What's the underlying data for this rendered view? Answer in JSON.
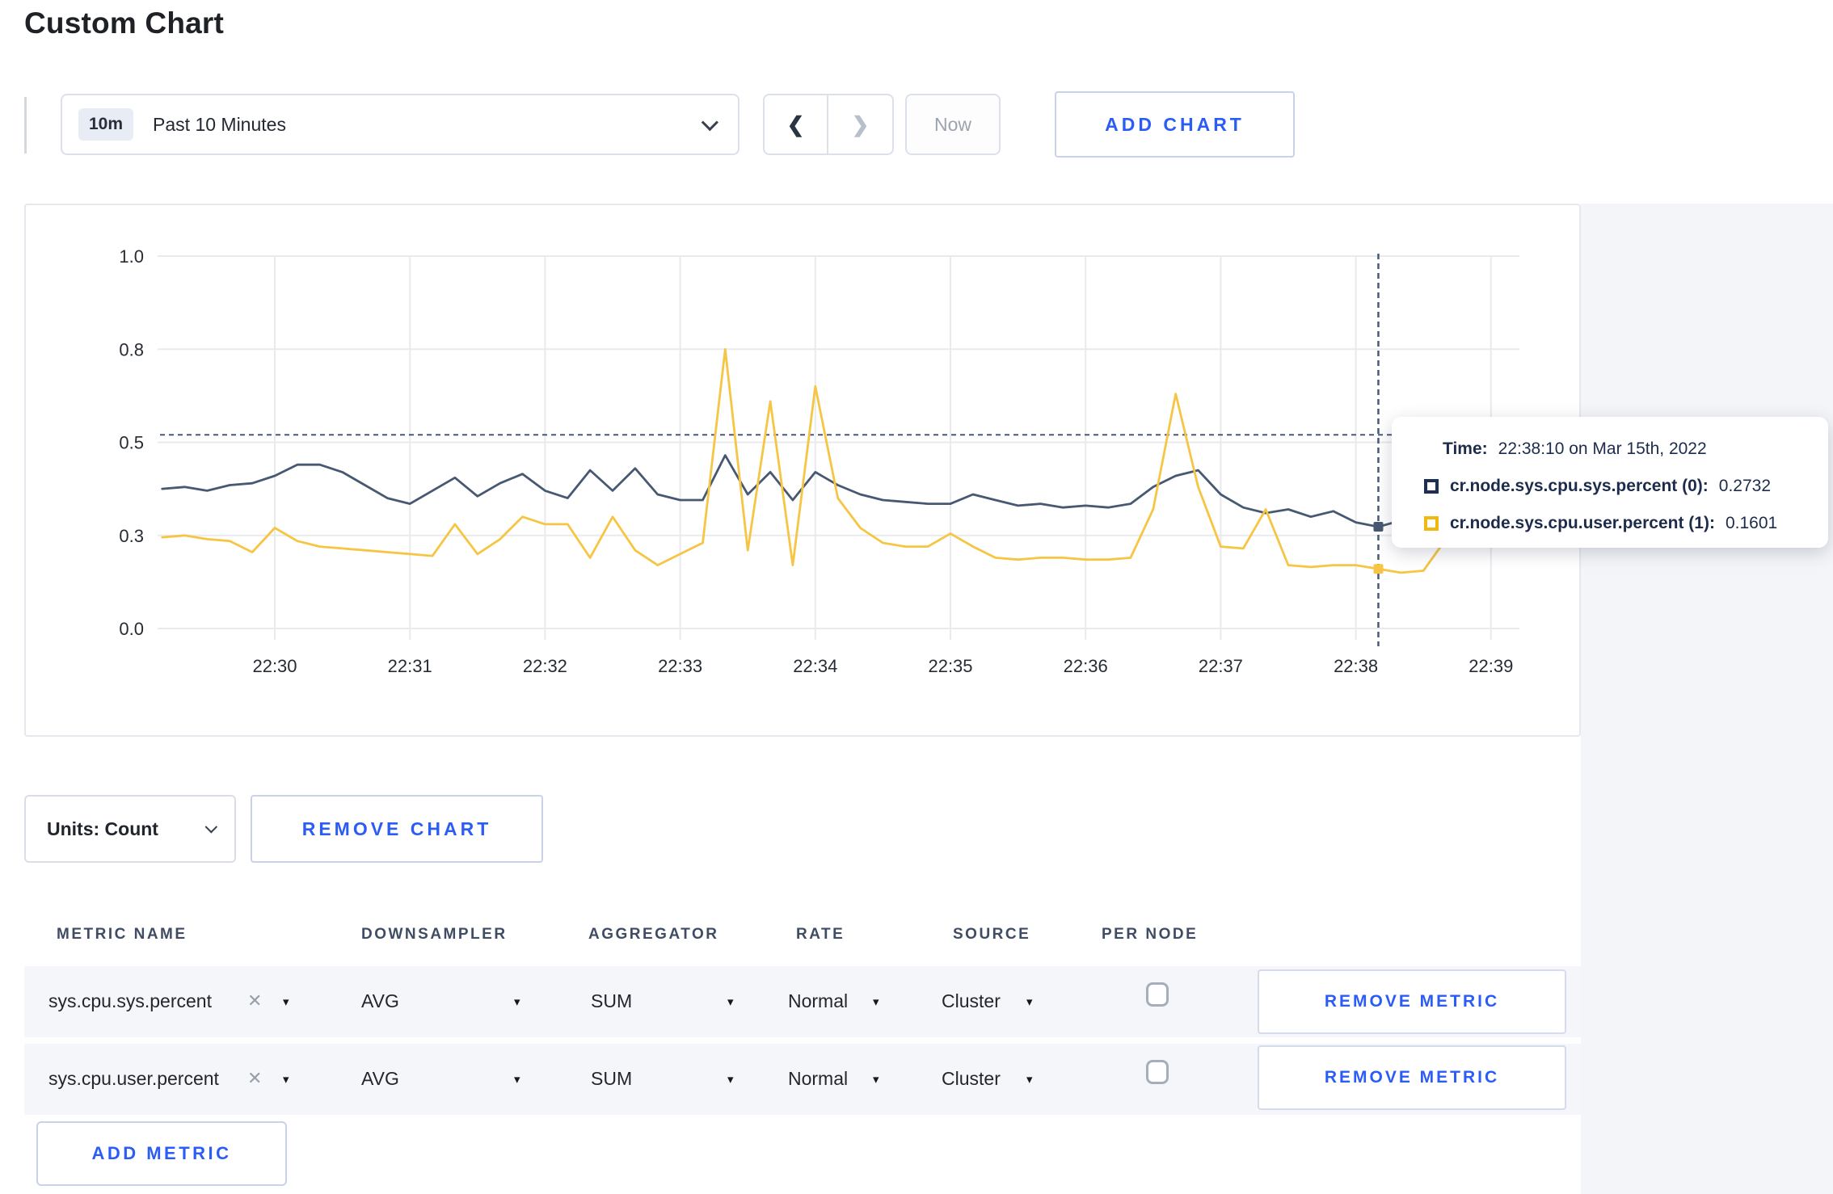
{
  "page": {
    "title": "Custom Chart"
  },
  "toolbar": {
    "range_badge": "10m",
    "range_label": "Past 10 Minutes",
    "prev_arrow": "❮",
    "next_arrow": "❯",
    "now_label": "Now",
    "add_chart_label": "ADD CHART"
  },
  "tooltip": {
    "time_label": "Time:",
    "time_value": "22:38:10 on Mar 15th, 2022",
    "rows": [
      {
        "label": "cr.node.sys.cpu.sys.percent (0):",
        "value": "0.2732",
        "swatch_color": "#1f2f52"
      },
      {
        "label": "cr.node.sys.cpu.user.percent (1):",
        "value": "0.1601",
        "swatch_color": "#f0b90e"
      }
    ]
  },
  "chart_data": {
    "type": "line",
    "title": "",
    "xlabel": "",
    "ylabel": "",
    "ylim": [
      0,
      1
    ],
    "grid": true,
    "x_ticks": [
      "22:30",
      "22:31",
      "22:32",
      "22:33",
      "22:34",
      "22:35",
      "22:36",
      "22:37",
      "22:38",
      "22:39"
    ],
    "y_tick_labels": [
      "0.0",
      "0.3",
      "0.5",
      "0.8",
      "1.0"
    ],
    "y_tick_values": [
      0,
      0.25,
      0.5,
      0.75,
      1.0
    ],
    "start_time": "22:29:10",
    "start_offset_sec": -50,
    "step_sec": 10,
    "series": [
      {
        "name": "cr.node.sys.cpu.sys.percent",
        "color": "#475872",
        "values": [
          0.375,
          0.38,
          0.37,
          0.385,
          0.39,
          0.41,
          0.44,
          0.44,
          0.42,
          0.385,
          0.35,
          0.335,
          0.37,
          0.405,
          0.355,
          0.39,
          0.415,
          0.37,
          0.35,
          0.425,
          0.37,
          0.43,
          0.36,
          0.345,
          0.345,
          0.465,
          0.36,
          0.42,
          0.345,
          0.42,
          0.385,
          0.36,
          0.345,
          0.34,
          0.335,
          0.335,
          0.36,
          0.345,
          0.33,
          0.335,
          0.325,
          0.33,
          0.325,
          0.335,
          0.38,
          0.41,
          0.425,
          0.36,
          0.325,
          0.31,
          0.32,
          0.3,
          0.315,
          0.285,
          0.2732,
          0.29,
          0.27,
          0.295,
          0.3,
          0.295,
          0.305
        ]
      },
      {
        "name": "cr.node.sys.cpu.user.percent",
        "color": "#f6c544",
        "values": [
          0.245,
          0.25,
          0.24,
          0.235,
          0.205,
          0.27,
          0.235,
          0.22,
          0.215,
          0.21,
          0.205,
          0.2,
          0.195,
          0.28,
          0.2,
          0.24,
          0.3,
          0.28,
          0.28,
          0.19,
          0.3,
          0.21,
          0.17,
          0.2,
          0.23,
          0.75,
          0.21,
          0.61,
          0.17,
          0.65,
          0.35,
          0.27,
          0.23,
          0.22,
          0.22,
          0.255,
          0.22,
          0.19,
          0.185,
          0.19,
          0.19,
          0.185,
          0.185,
          0.19,
          0.32,
          0.63,
          0.38,
          0.22,
          0.215,
          0.32,
          0.17,
          0.165,
          0.17,
          0.17,
          0.1601,
          0.15,
          0.155,
          0.24,
          0.295,
          0.22,
          0.28
        ]
      }
    ],
    "crosshair": {
      "index": 54,
      "time_label": "22:38:10",
      "h_value": 0.52
    },
    "legend_position": "tooltip"
  },
  "chart_controls": {
    "units_label": "Units: Count",
    "remove_chart_label": "REMOVE CHART"
  },
  "table": {
    "headers": [
      "METRIC NAME",
      "DOWNSAMPLER",
      "AGGREGATOR",
      "RATE",
      "SOURCE",
      "PER NODE"
    ],
    "rows": [
      {
        "metric": "sys.cpu.sys.percent",
        "downsampler": "AVG",
        "aggregator": "SUM",
        "rate": "Normal",
        "source": "Cluster",
        "per_node_checked": false,
        "remove_label": "REMOVE METRIC"
      },
      {
        "metric": "sys.cpu.user.percent",
        "downsampler": "AVG",
        "aggregator": "SUM",
        "rate": "Normal",
        "source": "Cluster",
        "per_node_checked": false,
        "remove_label": "REMOVE METRIC"
      }
    ],
    "add_metric_label": "ADD METRIC",
    "close_glyph": "✕",
    "caret_glyph": "▾"
  },
  "colors": {
    "accent_blue": "#2b5cf5",
    "series_sys": "#475872",
    "series_user": "#f6c544",
    "grid": "#e9eaed",
    "crosshair": "#49597a",
    "row_band": "#f5f6f9",
    "page_side_bg": "#f3f5f8"
  }
}
